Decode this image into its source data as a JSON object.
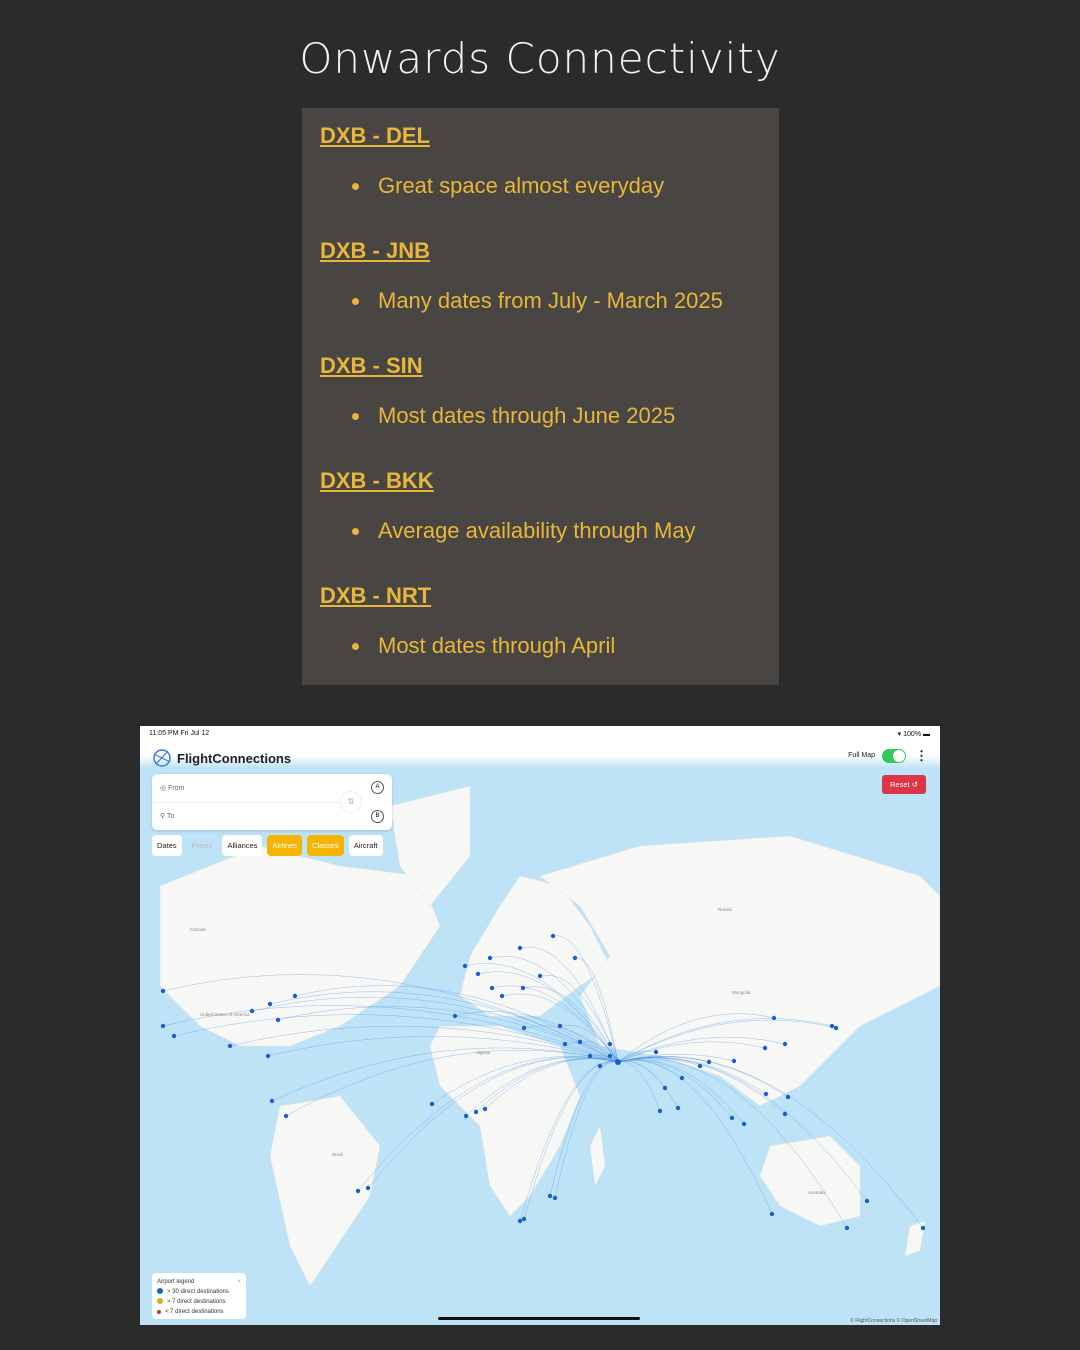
{
  "title": "Onwards Connectivity",
  "routes": [
    {
      "route": "DXB - DEL",
      "note": "Great space almost everyday"
    },
    {
      "route": "DXB - JNB",
      "note": "Many dates from July - March 2025"
    },
    {
      "route": "DXB - SIN",
      "note": "Most dates through June 2025"
    },
    {
      "route": "DXB - BKK",
      "note": "Average availability through May"
    },
    {
      "route": "DXB - NRT",
      "note": "Most dates through April"
    }
  ],
  "colors": {
    "accent": "#e8b73a",
    "panel": "#484543",
    "map_water": "#bfe3f6",
    "route_line": "#4a90e2",
    "hub_dot": "#1a5fd1",
    "reset": "#dc3545",
    "chip_active": "#f5b400"
  },
  "screenshot": {
    "status_time": "11:05 PM  Fri Jul 12",
    "battery": "100%",
    "app_name": "FlightConnections",
    "from_placeholder": "From",
    "to_placeholder": "To",
    "a_label": "A",
    "b_label": "B",
    "filters": [
      {
        "label": "Dates",
        "state": "normal"
      },
      {
        "label": "Prices",
        "state": "disabled"
      },
      {
        "label": "Alliances",
        "state": "normal"
      },
      {
        "label": "Airlines",
        "state": "active"
      },
      {
        "label": "Classes",
        "state": "active"
      },
      {
        "label": "Aircraft",
        "state": "normal"
      }
    ],
    "full_map_label": "Full Map",
    "full_map_on": true,
    "reset_label": "Reset",
    "legend": {
      "title": "Airport legend",
      "close": "×",
      "items": [
        {
          "label": "> 30 direct destinations",
          "color": "#1a5fd1"
        },
        {
          "label": "> 7 direct destinations",
          "color": "#e0a820"
        },
        {
          "label": "< 7 direct destinations",
          "color": "#c0392b"
        }
      ]
    },
    "credit": "© FlightConnections © OpenStreetMap",
    "map_labels": [
      "Canada",
      "United States of America",
      "Russia",
      "Brazil",
      "Australia",
      "Algeria",
      "Mongolia"
    ]
  }
}
